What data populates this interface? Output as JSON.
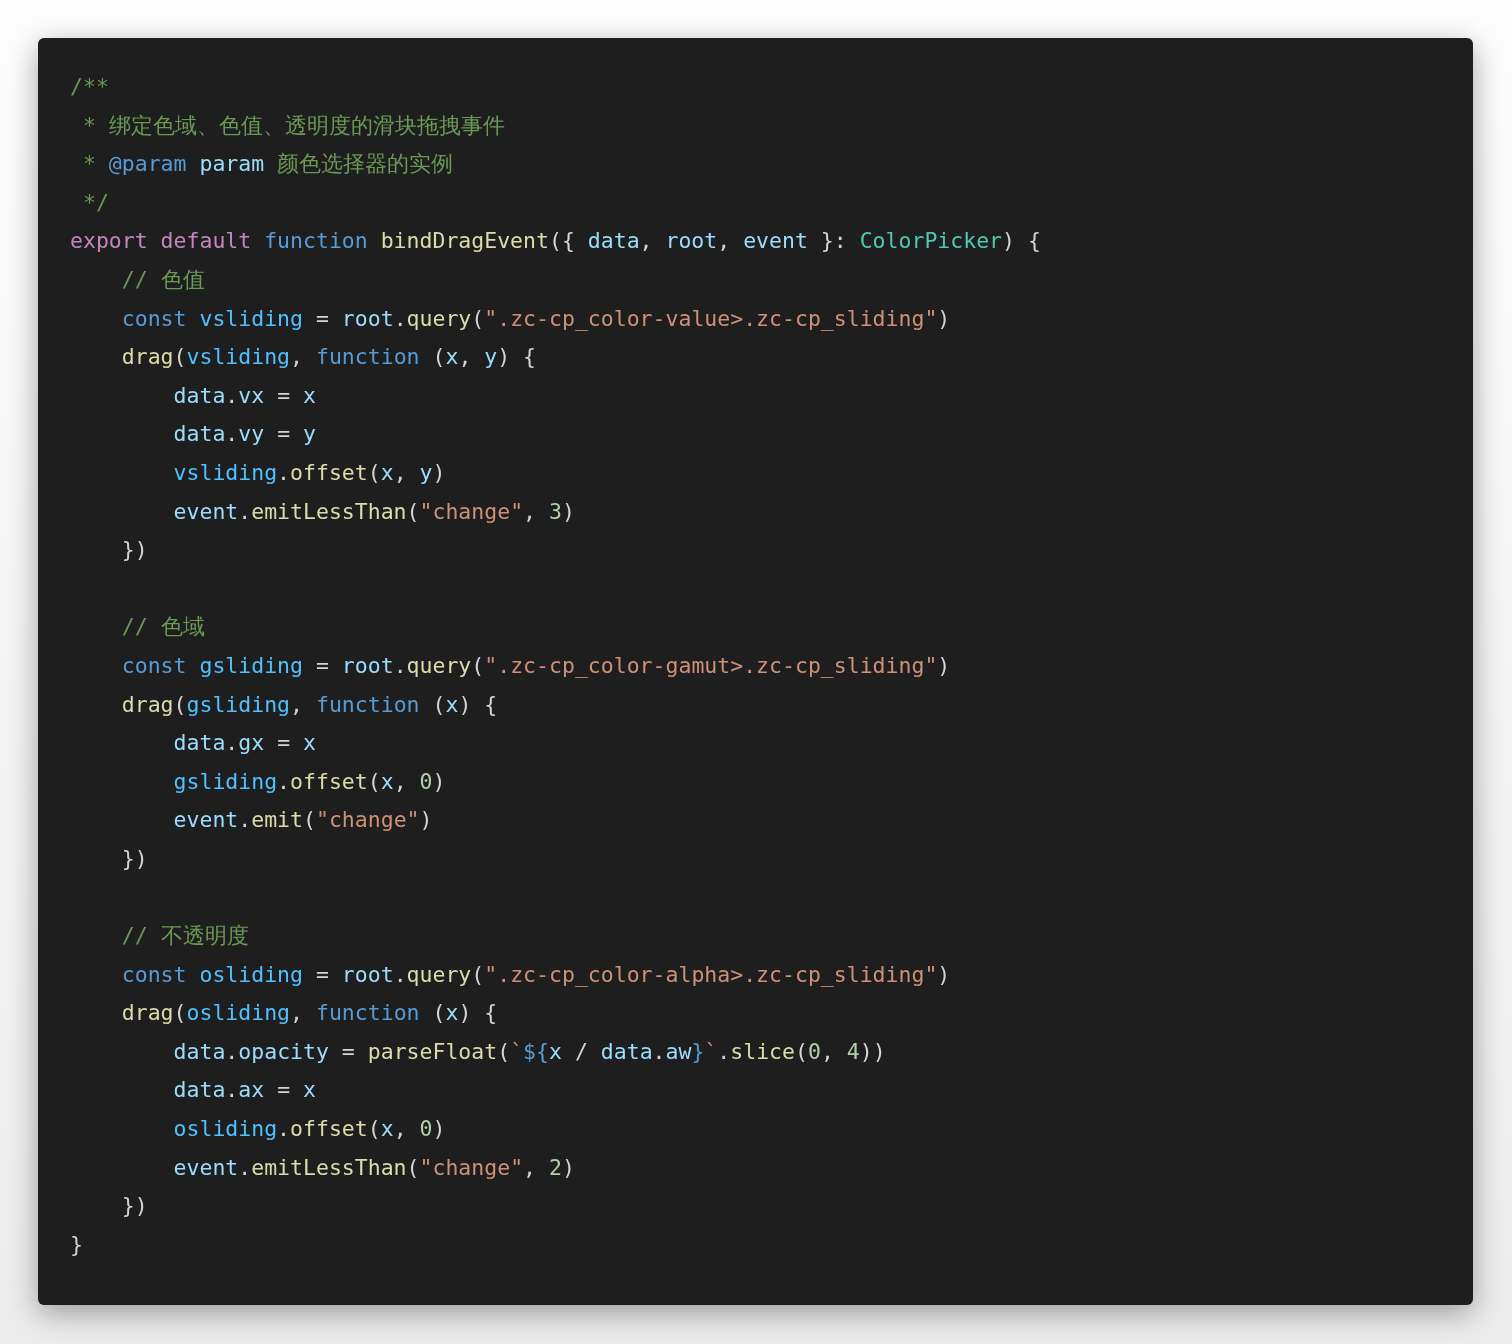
{
  "code_blocks": [
    {
      "lines": [
        {
          "tokens": [
            {
              "kind": "comment",
              "text": "/**"
            }
          ]
        },
        {
          "tokens": [
            {
              "kind": "comment",
              "text": " * 绑定色域、色值、透明度的滑块拖拽事件"
            }
          ]
        },
        {
          "tokens": [
            {
              "kind": "comment",
              "text": " * "
            },
            {
              "kind": "storage",
              "text": "@param "
            },
            {
              "kind": "variable",
              "text": "param"
            },
            {
              "kind": "comment",
              "text": " 颜色选择器的实例"
            }
          ]
        },
        {
          "tokens": [
            {
              "kind": "comment",
              "text": " */"
            }
          ]
        },
        {
          "tokens": [
            {
              "kind": "keyword",
              "text": "export "
            },
            {
              "kind": "keyword",
              "text": "default "
            },
            {
              "kind": "storage",
              "text": "function "
            },
            {
              "kind": "function",
              "text": "bindDragEvent"
            },
            {
              "kind": "plain",
              "text": "({ "
            },
            {
              "kind": "variable",
              "text": "data"
            },
            {
              "kind": "plain",
              "text": ", "
            },
            {
              "kind": "variable",
              "text": "root"
            },
            {
              "kind": "plain",
              "text": ", "
            },
            {
              "kind": "variable",
              "text": "event"
            },
            {
              "kind": "plain",
              "text": " }: "
            },
            {
              "kind": "type",
              "text": "ColorPicker"
            },
            {
              "kind": "plain",
              "text": ") {"
            }
          ]
        },
        {
          "tokens": [
            {
              "kind": "comment",
              "text": "    // 色值"
            }
          ]
        },
        {
          "tokens": [
            {
              "kind": "storage",
              "text": "    const "
            },
            {
              "kind": "constant",
              "text": "vsliding"
            },
            {
              "kind": "plain",
              "text": " = "
            },
            {
              "kind": "variable",
              "text": "root"
            },
            {
              "kind": "plain",
              "text": "."
            },
            {
              "kind": "function",
              "text": "query"
            },
            {
              "kind": "plain",
              "text": "("
            },
            {
              "kind": "string",
              "text": "\".zc-cp_color-value>.zc-cp_sliding\""
            },
            {
              "kind": "plain",
              "text": ")"
            }
          ]
        },
        {
          "tokens": [
            {
              "kind": "function",
              "text": "    drag"
            },
            {
              "kind": "plain",
              "text": "("
            },
            {
              "kind": "constant",
              "text": "vsliding"
            },
            {
              "kind": "plain",
              "text": ", "
            },
            {
              "kind": "storage",
              "text": "function"
            },
            {
              "kind": "plain",
              "text": " ("
            },
            {
              "kind": "variable",
              "text": "x"
            },
            {
              "kind": "plain",
              "text": ", "
            },
            {
              "kind": "variable",
              "text": "y"
            },
            {
              "kind": "plain",
              "text": ") {"
            }
          ]
        },
        {
          "tokens": [
            {
              "kind": "variable",
              "text": "        data"
            },
            {
              "kind": "plain",
              "text": "."
            },
            {
              "kind": "variable",
              "text": "vx"
            },
            {
              "kind": "plain",
              "text": " = "
            },
            {
              "kind": "variable",
              "text": "x"
            }
          ]
        },
        {
          "tokens": [
            {
              "kind": "variable",
              "text": "        data"
            },
            {
              "kind": "plain",
              "text": "."
            },
            {
              "kind": "variable",
              "text": "vy"
            },
            {
              "kind": "plain",
              "text": " = "
            },
            {
              "kind": "variable",
              "text": "y"
            }
          ]
        },
        {
          "tokens": [
            {
              "kind": "constant",
              "text": "        vsliding"
            },
            {
              "kind": "plain",
              "text": "."
            },
            {
              "kind": "function",
              "text": "offset"
            },
            {
              "kind": "plain",
              "text": "("
            },
            {
              "kind": "variable",
              "text": "x"
            },
            {
              "kind": "plain",
              "text": ", "
            },
            {
              "kind": "variable",
              "text": "y"
            },
            {
              "kind": "plain",
              "text": ")"
            }
          ]
        },
        {
          "tokens": [
            {
              "kind": "variable",
              "text": "        event"
            },
            {
              "kind": "plain",
              "text": "."
            },
            {
              "kind": "function",
              "text": "emitLessThan"
            },
            {
              "kind": "plain",
              "text": "("
            },
            {
              "kind": "string",
              "text": "\"change\""
            },
            {
              "kind": "plain",
              "text": ", "
            },
            {
              "kind": "number",
              "text": "3"
            },
            {
              "kind": "plain",
              "text": ")"
            }
          ]
        },
        {
          "tokens": [
            {
              "kind": "plain",
              "text": "    })"
            }
          ]
        }
      ]
    },
    {
      "lines": [
        {
          "tokens": [
            {
              "kind": "comment",
              "text": "    // 色域"
            }
          ]
        },
        {
          "tokens": [
            {
              "kind": "storage",
              "text": "    const "
            },
            {
              "kind": "constant",
              "text": "gsliding"
            },
            {
              "kind": "plain",
              "text": " = "
            },
            {
              "kind": "variable",
              "text": "root"
            },
            {
              "kind": "plain",
              "text": "."
            },
            {
              "kind": "function",
              "text": "query"
            },
            {
              "kind": "plain",
              "text": "("
            },
            {
              "kind": "string",
              "text": "\".zc-cp_color-gamut>.zc-cp_sliding\""
            },
            {
              "kind": "plain",
              "text": ")"
            }
          ]
        },
        {
          "tokens": [
            {
              "kind": "function",
              "text": "    drag"
            },
            {
              "kind": "plain",
              "text": "("
            },
            {
              "kind": "constant",
              "text": "gsliding"
            },
            {
              "kind": "plain",
              "text": ", "
            },
            {
              "kind": "storage",
              "text": "function"
            },
            {
              "kind": "plain",
              "text": " ("
            },
            {
              "kind": "variable",
              "text": "x"
            },
            {
              "kind": "plain",
              "text": ") {"
            }
          ]
        },
        {
          "tokens": [
            {
              "kind": "variable",
              "text": "        data"
            },
            {
              "kind": "plain",
              "text": "."
            },
            {
              "kind": "variable",
              "text": "gx"
            },
            {
              "kind": "plain",
              "text": " = "
            },
            {
              "kind": "variable",
              "text": "x"
            }
          ]
        },
        {
          "tokens": [
            {
              "kind": "constant",
              "text": "        gsliding"
            },
            {
              "kind": "plain",
              "text": "."
            },
            {
              "kind": "function",
              "text": "offset"
            },
            {
              "kind": "plain",
              "text": "("
            },
            {
              "kind": "variable",
              "text": "x"
            },
            {
              "kind": "plain",
              "text": ", "
            },
            {
              "kind": "number",
              "text": "0"
            },
            {
              "kind": "plain",
              "text": ")"
            }
          ]
        },
        {
          "tokens": [
            {
              "kind": "variable",
              "text": "        event"
            },
            {
              "kind": "plain",
              "text": "."
            },
            {
              "kind": "function",
              "text": "emit"
            },
            {
              "kind": "plain",
              "text": "("
            },
            {
              "kind": "string",
              "text": "\"change\""
            },
            {
              "kind": "plain",
              "text": ")"
            }
          ]
        },
        {
          "tokens": [
            {
              "kind": "plain",
              "text": "    })"
            }
          ]
        }
      ]
    },
    {
      "lines": [
        {
          "tokens": [
            {
              "kind": "comment",
              "text": "    // 不透明度"
            }
          ]
        },
        {
          "tokens": [
            {
              "kind": "storage",
              "text": "    const "
            },
            {
              "kind": "constant",
              "text": "osliding"
            },
            {
              "kind": "plain",
              "text": " = "
            },
            {
              "kind": "variable",
              "text": "root"
            },
            {
              "kind": "plain",
              "text": "."
            },
            {
              "kind": "function",
              "text": "query"
            },
            {
              "kind": "plain",
              "text": "("
            },
            {
              "kind": "string",
              "text": "\".zc-cp_color-alpha>.zc-cp_sliding\""
            },
            {
              "kind": "plain",
              "text": ")"
            }
          ]
        },
        {
          "tokens": [
            {
              "kind": "function",
              "text": "    drag"
            },
            {
              "kind": "plain",
              "text": "("
            },
            {
              "kind": "constant",
              "text": "osliding"
            },
            {
              "kind": "plain",
              "text": ", "
            },
            {
              "kind": "storage",
              "text": "function"
            },
            {
              "kind": "plain",
              "text": " ("
            },
            {
              "kind": "variable",
              "text": "x"
            },
            {
              "kind": "plain",
              "text": ") {"
            }
          ]
        },
        {
          "tokens": [
            {
              "kind": "variable",
              "text": "        data"
            },
            {
              "kind": "plain",
              "text": "."
            },
            {
              "kind": "variable",
              "text": "opacity"
            },
            {
              "kind": "plain",
              "text": " = "
            },
            {
              "kind": "function",
              "text": "parseFloat"
            },
            {
              "kind": "plain",
              "text": "("
            },
            {
              "kind": "string",
              "text": "`"
            },
            {
              "kind": "storage",
              "text": "${"
            },
            {
              "kind": "variable",
              "text": "x"
            },
            {
              "kind": "plain",
              "text": " / "
            },
            {
              "kind": "variable",
              "text": "data"
            },
            {
              "kind": "plain",
              "text": "."
            },
            {
              "kind": "variable",
              "text": "aw"
            },
            {
              "kind": "storage",
              "text": "}"
            },
            {
              "kind": "string",
              "text": "`"
            },
            {
              "kind": "plain",
              "text": "."
            },
            {
              "kind": "function",
              "text": "slice"
            },
            {
              "kind": "plain",
              "text": "("
            },
            {
              "kind": "number",
              "text": "0"
            },
            {
              "kind": "plain",
              "text": ", "
            },
            {
              "kind": "number",
              "text": "4"
            },
            {
              "kind": "plain",
              "text": "))"
            }
          ]
        },
        {
          "tokens": [
            {
              "kind": "variable",
              "text": "        data"
            },
            {
              "kind": "plain",
              "text": "."
            },
            {
              "kind": "variable",
              "text": "ax"
            },
            {
              "kind": "plain",
              "text": " = "
            },
            {
              "kind": "variable",
              "text": "x"
            }
          ]
        },
        {
          "tokens": [
            {
              "kind": "constant",
              "text": "        osliding"
            },
            {
              "kind": "plain",
              "text": "."
            },
            {
              "kind": "function",
              "text": "offset"
            },
            {
              "kind": "plain",
              "text": "("
            },
            {
              "kind": "variable",
              "text": "x"
            },
            {
              "kind": "plain",
              "text": ", "
            },
            {
              "kind": "number",
              "text": "0"
            },
            {
              "kind": "plain",
              "text": ")"
            }
          ]
        },
        {
          "tokens": [
            {
              "kind": "variable",
              "text": "        event"
            },
            {
              "kind": "plain",
              "text": "."
            },
            {
              "kind": "function",
              "text": "emitLessThan"
            },
            {
              "kind": "plain",
              "text": "("
            },
            {
              "kind": "string",
              "text": "\"change\""
            },
            {
              "kind": "plain",
              "text": ", "
            },
            {
              "kind": "number",
              "text": "2"
            },
            {
              "kind": "plain",
              "text": ")"
            }
          ]
        },
        {
          "tokens": [
            {
              "kind": "plain",
              "text": "    })"
            }
          ]
        },
        {
          "tokens": [
            {
              "kind": "plain",
              "text": "}"
            }
          ]
        }
      ]
    }
  ]
}
